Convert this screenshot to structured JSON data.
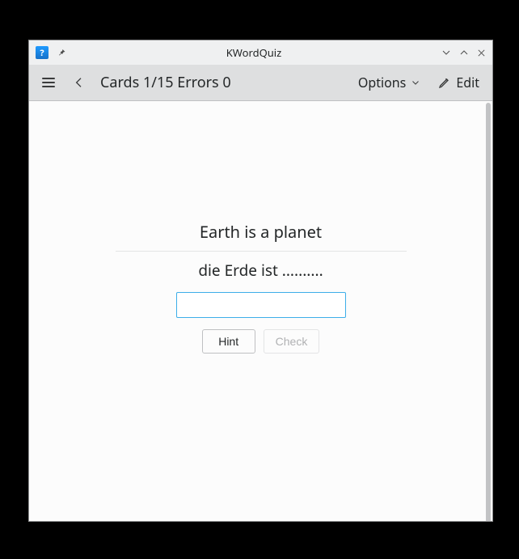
{
  "window": {
    "title": "KWordQuiz"
  },
  "toolbar": {
    "title_prefix": "Cards",
    "progress_current": 1,
    "progress_total": 15,
    "errors_label": "Errors",
    "errors_count": 0,
    "options_label": "Options",
    "edit_label": "Edit"
  },
  "card": {
    "question": "Earth is a planet",
    "prompt": "die Erde ist ..........",
    "answer_value": "",
    "hint_label": "Hint",
    "check_label": "Check"
  }
}
